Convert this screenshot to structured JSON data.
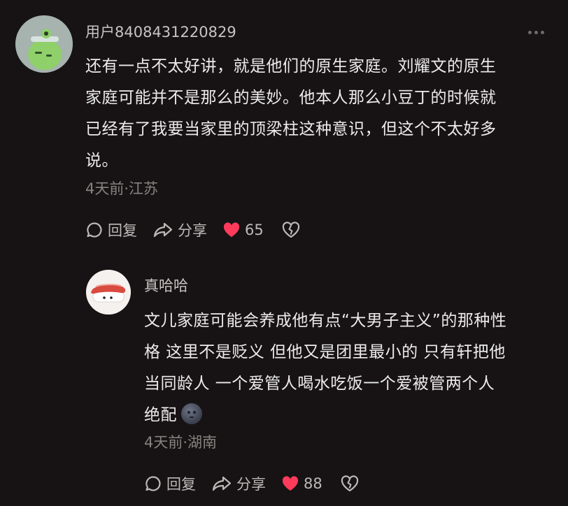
{
  "comments": [
    {
      "username": "用户8408431220829",
      "lines": [
        "还有一点不太好讲，就是他们的原生家庭。刘耀文的原生",
        "家庭可能并不是那么的美妙。他本人那么小豆丁的时候就",
        "已经有了我要当家里的顶梁柱这种意识，但这个不太好多",
        "说。"
      ],
      "meta": "4天前·江苏",
      "reply_label": "回复",
      "share_label": "分享",
      "like_count": "65",
      "avatar_icon": "green-cartoon-avatar"
    },
    {
      "username": "真哈哈",
      "lines": [
        "文儿家庭可能会养成他有点“大男子主义”的那种性",
        "格 这里不是贬义 但他又是团里最小的 只有轩把他",
        "当同龄人 一个爱管人喝水吃饭一个爱被管两个人",
        "绝配"
      ],
      "meta": "4天前·湖南",
      "reply_label": "回复",
      "share_label": "分享",
      "like_count": "88",
      "avatar_icon": "sushi-avatar",
      "trailing_emoji": "new-moon-face-emoji"
    }
  ],
  "colors": {
    "background": "#171314",
    "like": "#ff3b5c",
    "meta": "#86827f"
  }
}
